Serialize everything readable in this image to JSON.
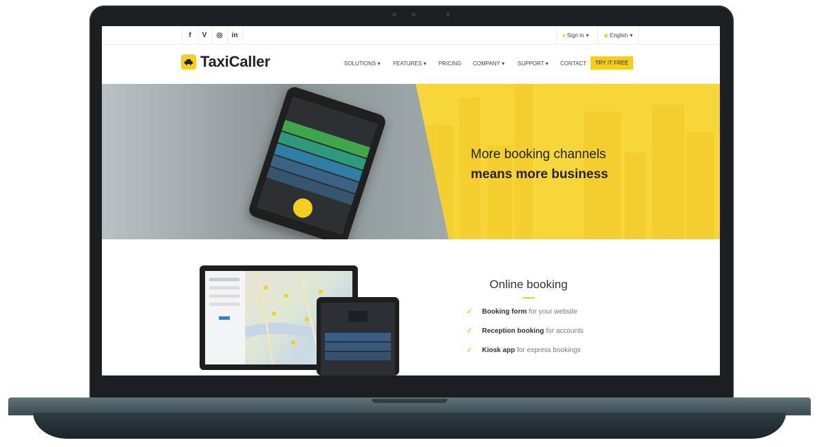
{
  "topbar": {
    "social": [
      {
        "icon": "facebook-icon",
        "glyph": "f"
      },
      {
        "icon": "vimeo-icon",
        "glyph": "V"
      },
      {
        "icon": "instagram-icon",
        "glyph": "◎"
      },
      {
        "icon": "linkedin-icon",
        "glyph": "in"
      }
    ],
    "sign_in": "Sign in",
    "language": "English"
  },
  "header": {
    "brand": "TaxiCaller",
    "nav": [
      "SOLUTIONS",
      "FEATURES",
      "PRICING",
      "COMPANY",
      "SUPPORT",
      "CONTACT"
    ],
    "cta": "TRY IT FREE"
  },
  "hero": {
    "line1": "More booking channels",
    "line2": "means more business"
  },
  "booking": {
    "title": "Online booking",
    "features": [
      {
        "strong": "Booking form",
        "rest": "for your website"
      },
      {
        "strong": "Reception booking",
        "rest": "for accounts"
      },
      {
        "strong": "Kiosk app",
        "rest": "for express bookings"
      }
    ]
  },
  "colors": {
    "accent": "#f5cf1c",
    "bezel": "#1c1f22",
    "base": "#3b4c52"
  }
}
